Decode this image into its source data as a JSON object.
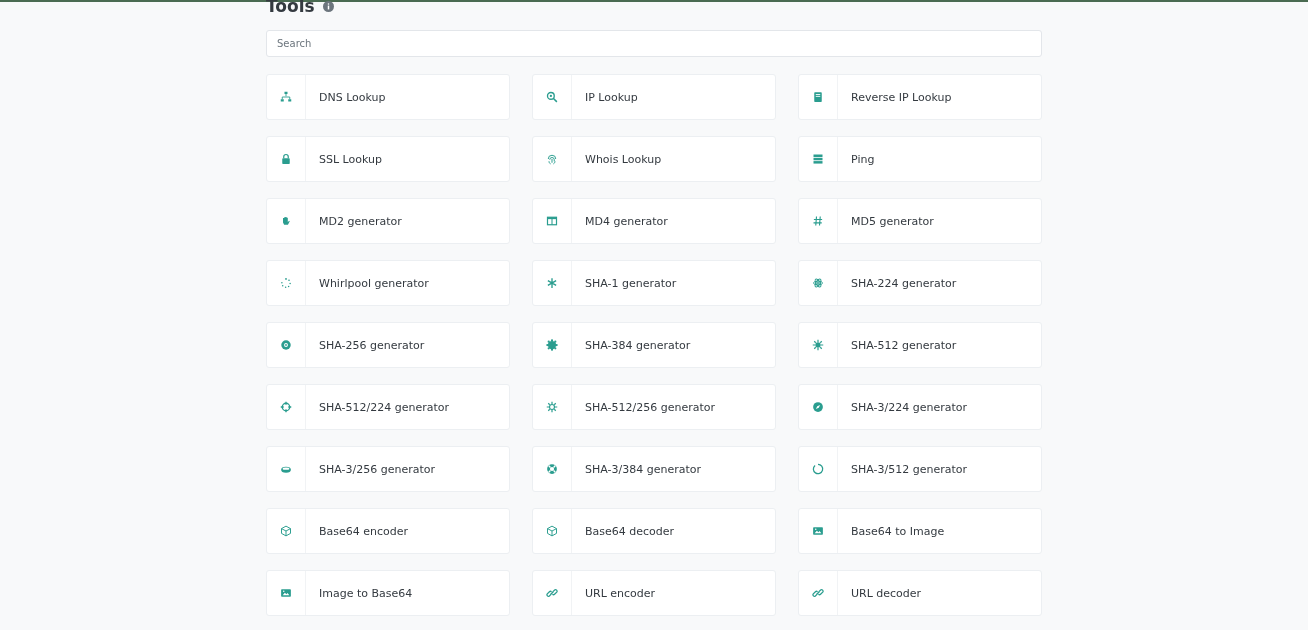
{
  "page": {
    "title": "Tools"
  },
  "search": {
    "placeholder": "Search"
  },
  "tools": [
    {
      "label": "DNS Lookup"
    },
    {
      "label": "IP Lookup"
    },
    {
      "label": "Reverse IP Lookup"
    },
    {
      "label": "SSL Lookup"
    },
    {
      "label": "Whois Lookup"
    },
    {
      "label": "Ping"
    },
    {
      "label": "MD2 generator"
    },
    {
      "label": "MD4 generator"
    },
    {
      "label": "MD5 generator"
    },
    {
      "label": "Whirlpool generator"
    },
    {
      "label": "SHA-1 generator"
    },
    {
      "label": "SHA-224 generator"
    },
    {
      "label": "SHA-256 generator"
    },
    {
      "label": "SHA-384 generator"
    },
    {
      "label": "SHA-512 generator"
    },
    {
      "label": "SHA-512/224 generator"
    },
    {
      "label": "SHA-512/256 generator"
    },
    {
      "label": "SHA-3/224 generator"
    },
    {
      "label": "SHA-3/256 generator"
    },
    {
      "label": "SHA-3/384 generator"
    },
    {
      "label": "SHA-3/512 generator"
    },
    {
      "label": "Base64 encoder"
    },
    {
      "label": "Base64 decoder"
    },
    {
      "label": "Base64 to Image"
    },
    {
      "label": "Image to Base64"
    },
    {
      "label": "URL encoder"
    },
    {
      "label": "URL decoder"
    }
  ]
}
